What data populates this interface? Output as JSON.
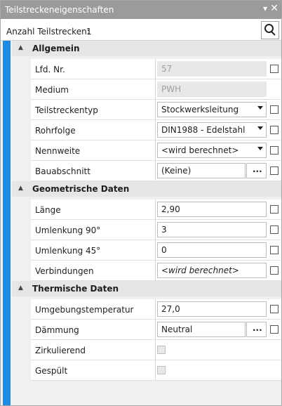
{
  "window": {
    "title": "Teilstreckeneigenschaften",
    "pin_icon": "▾",
    "close_icon": "✕"
  },
  "count": {
    "label": "Anzahl Teilstrecken:",
    "value": "1"
  },
  "sections": {
    "allgemein": {
      "title": "Allgemein",
      "lfd_nr": {
        "label": "Lfd. Nr.",
        "value": "57"
      },
      "medium": {
        "label": "Medium",
        "value": "PWH"
      },
      "teilstreckentyp": {
        "label": "Teilstreckentyp",
        "value": "Stockwerksleitung"
      },
      "rohrfolge": {
        "label": "Rohrfolge",
        "value": "DIN1988 - Edelstahl"
      },
      "nennweite": {
        "label": "Nennweite",
        "value": "<wird berechnet>"
      },
      "bauabschnitt": {
        "label": "Bauabschnitt",
        "value": "(Keine)",
        "button": "..."
      }
    },
    "geometrie": {
      "title": "Geometrische Daten",
      "laenge": {
        "label": "Länge",
        "value": "2,90"
      },
      "umlenkung90": {
        "label": "Umlenkung 90°",
        "value": "3"
      },
      "umlenkung45": {
        "label": "Umlenkung 45°",
        "value": "0"
      },
      "verbindungen": {
        "label": "Verbindungen",
        "value": "<wird berechnet>"
      }
    },
    "thermisch": {
      "title": "Thermische Daten",
      "umgebungstemperatur": {
        "label": "Umgebungstemperatur",
        "value": "27,0"
      },
      "daemmung": {
        "label": "Dämmung",
        "value": "Neutral",
        "button": "..."
      },
      "zirkulierend": {
        "label": "Zirkulierend"
      },
      "gespuelt": {
        "label": "Gespült"
      }
    }
  },
  "colors": {
    "accent": "#1e8be0",
    "titlebar": "#9b9b9b"
  }
}
